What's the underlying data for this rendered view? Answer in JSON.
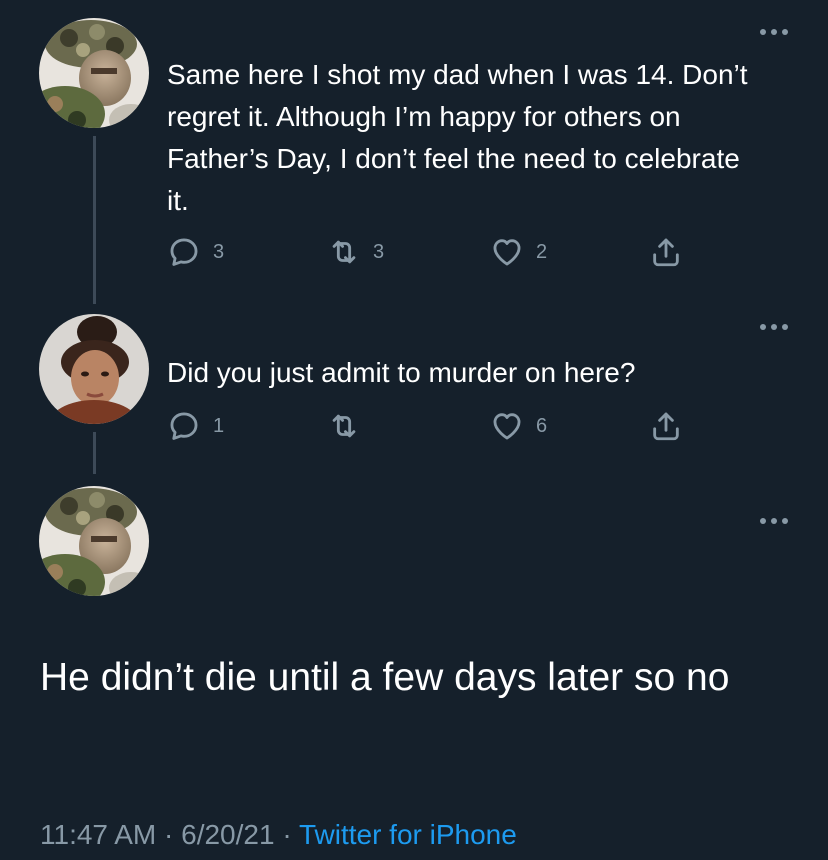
{
  "tweets": [
    {
      "text": "Same here I shot my dad when I was 14. Don’t regret it. Although I’m happy for others on Father’s Day, I don’t feel the need to celebrate it.",
      "replies": "3",
      "retweets": "3",
      "likes": "2"
    },
    {
      "text": "Did you just admit to murder on here?",
      "replies": "1",
      "retweets": "",
      "likes": "6"
    }
  ],
  "main_tweet": {
    "text": "He didn’t die until a few days later so no",
    "time": "11:47 AM",
    "separator": "·",
    "date": "6/20/21",
    "source": "Twitter for iPhone"
  },
  "icons": {
    "reply": "reply-icon",
    "retweet": "retweet-icon",
    "like": "heart-icon",
    "share": "share-icon",
    "more": "more-icon"
  },
  "colors": {
    "background": "#15202b",
    "text": "#ffffff",
    "secondary": "#8899a6",
    "link": "#1d9bf0",
    "thread_line": "#3d4a58"
  }
}
